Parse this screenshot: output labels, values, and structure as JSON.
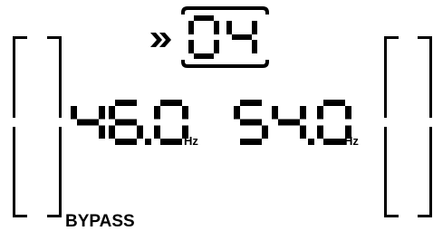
{
  "display": {
    "program_number": "04",
    "input_frequency": "46.0",
    "input_unit": "Hz",
    "output_frequency": "54.0",
    "output_unit": "Hz",
    "mode_label": "BYPASS",
    "indicator_icon": "double-chevron-right-icon",
    "segment_color": "#000000",
    "background_color": "#ffffff"
  }
}
